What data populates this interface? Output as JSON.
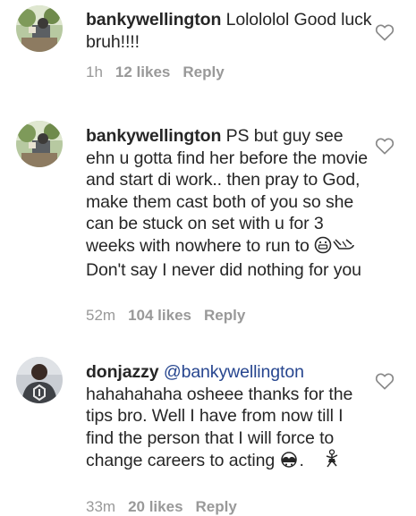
{
  "comments": [
    {
      "username": "bankywellington",
      "mention": "",
      "text": " Lolololol Good luck bruh!!!!",
      "time": "1h",
      "likes": "12 likes",
      "reply": "Reply",
      "avatar_icon": "profile-photo-outdoor"
    },
    {
      "username": "bankywellington",
      "mention": "",
      "text_before_emoji": " PS but guy see ehn u gotta find her before the movie and start di work.. then pray to God, make them cast both of you so she can be stuck on set with u for 3 weeks with nowhere to run to ",
      "text_after_emoji": " Don't say I never did nothing for you",
      "emoji_icons": [
        "grinning-face-icon",
        "running-shoe-icon"
      ],
      "time": "52m",
      "likes": "104 likes",
      "reply": "Reply",
      "avatar_icon": "profile-photo-outdoor"
    },
    {
      "username": "donjazzy",
      "mention": "@bankywellington",
      "text": " hahahahaha osheee thanks for the tips bro. Well I have from now till I find the person that I will force to change careers to acting ",
      "text_tail": ".",
      "emoji_icons": [
        "see-no-evil-icon",
        "dancer-icon"
      ],
      "time": "33m",
      "likes": "20 likes",
      "reply": "Reply",
      "avatar_icon": "profile-photo-man"
    }
  ],
  "colors": {
    "text": "#262626",
    "meta": "#999999",
    "mention": "#27468f",
    "heart_stroke": "#888888"
  }
}
